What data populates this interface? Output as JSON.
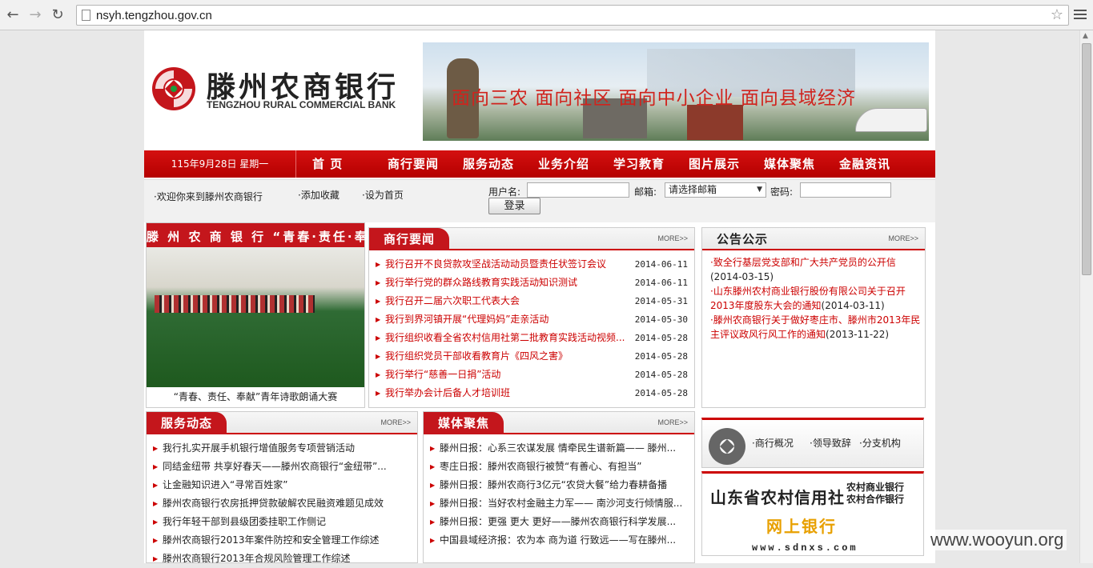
{
  "browser": {
    "url": "nsyh.tengzhou.gov.cn"
  },
  "header": {
    "bank_cn": "滕州农商银行",
    "bank_en": "TENGZHOU RURAL COMMERCIAL BANK",
    "slogan": "面向三农  面向社区  面向中小企业  面向县域经济"
  },
  "nav": {
    "date": "115年9月28日  星期一",
    "items": [
      "首  页",
      "商行要闻",
      "服务动态",
      "业务介绍",
      "学习教育",
      "图片展示",
      "媒体聚焦",
      "金融资讯"
    ]
  },
  "toolbar": {
    "welcome": "·欢迎你来到滕州农商银行",
    "fav": "·添加收藏",
    "home": "·设为首页",
    "user_label": "用户名:",
    "mail_label": "邮箱:",
    "mail_select": "请选择邮箱",
    "pwd_label": "密码:",
    "login": "登录"
  },
  "photo": {
    "banner_text": "滕 州 农 商 银 行 “青春·责任·奉献” 青年诗歌朗诵大赛",
    "caption": "“青春、责任、奉献”青年诗歌朗诵大赛"
  },
  "news": {
    "title": "商行要闻",
    "more": "MORE>>",
    "items": [
      {
        "t": "我行召开不良贷款攻坚战活动动员暨责任状签订会议",
        "d": "2014-06-11"
      },
      {
        "t": "我行举行党的群众路线教育实践活动知识测试",
        "d": "2014-06-11"
      },
      {
        "t": "我行召开二届六次职工代表大会",
        "d": "2014-05-31"
      },
      {
        "t": "我行到界河镇开展“代理妈妈”走亲活动",
        "d": "2014-05-30"
      },
      {
        "t": "我行组织收看全省农村信用社第二批教育实践活动视频...",
        "d": "2014-05-28"
      },
      {
        "t": "我行组织党员干部收看教育片《四风之害》",
        "d": "2014-05-28"
      },
      {
        "t": "我行举行“慈善一日捐”活动",
        "d": "2014-05-28"
      },
      {
        "t": "我行举办会计后备人才培训班",
        "d": "2014-05-28"
      }
    ]
  },
  "notice": {
    "title": "公告公示",
    "more": "MORE>>",
    "items": [
      {
        "t": "·致全行基层党支部和广大共产党员的公开信",
        "d": "(2014-03-15)"
      },
      {
        "t": "·山东滕州农村商业银行股份有限公司关于召开2013年度股东大会的通知",
        "d": "(2014-03-11)"
      },
      {
        "t": "·滕州农商银行关于做好枣庄市、滕州市2013年民主评议政风行风工作的通知",
        "d": "(2013-11-22)"
      }
    ]
  },
  "service": {
    "title": "服务动态",
    "more": "MORE>>",
    "items": [
      "我行扎实开展手机银行增值服务专项营销活动",
      "同结金纽带 共享好春天——滕州农商银行“金纽带”...",
      "让金融知识进入“寻常百姓家”",
      "滕州农商银行农房抵押贷款破解农民融资难题见成效",
      "我行年轻干部到县级团委挂职工作侧记",
      "滕州农商银行2013年案件防控和安全管理工作综述",
      "滕州农商银行2013年合规风险管理工作综述"
    ]
  },
  "media": {
    "title": "媒体聚焦",
    "more": "MORE>>",
    "items": [
      "滕州日报：心系三农谋发展 情牵民生谱新篇—— 滕州...",
      "枣庄日报：滕州农商银行被赞“有善心、有担当”",
      "滕州日报：滕州农商行3亿元“农贷大餐”给力春耕备播",
      "滕州日报：当好农村金融主力军—— 南沙河支行倾情服...",
      "滕州日报：更强 更大 更好——滕州农商银行科学发展...",
      "中国县域经济报：农为本 商为道 行致远——写在滕州..."
    ]
  },
  "links": {
    "a": "·商行概况",
    "b": "·领导致辞",
    "c": "·分支机构"
  },
  "ad": {
    "line1": "山东省农村信用社",
    "line2a": "农村商业银行",
    "line2b": "农村合作银行",
    "line3": "网上银行",
    "line4": "www.sdnxs.com"
  },
  "watermark": "www.wooyun.org",
  "colors": {
    "brand_red": "#c4161c"
  }
}
